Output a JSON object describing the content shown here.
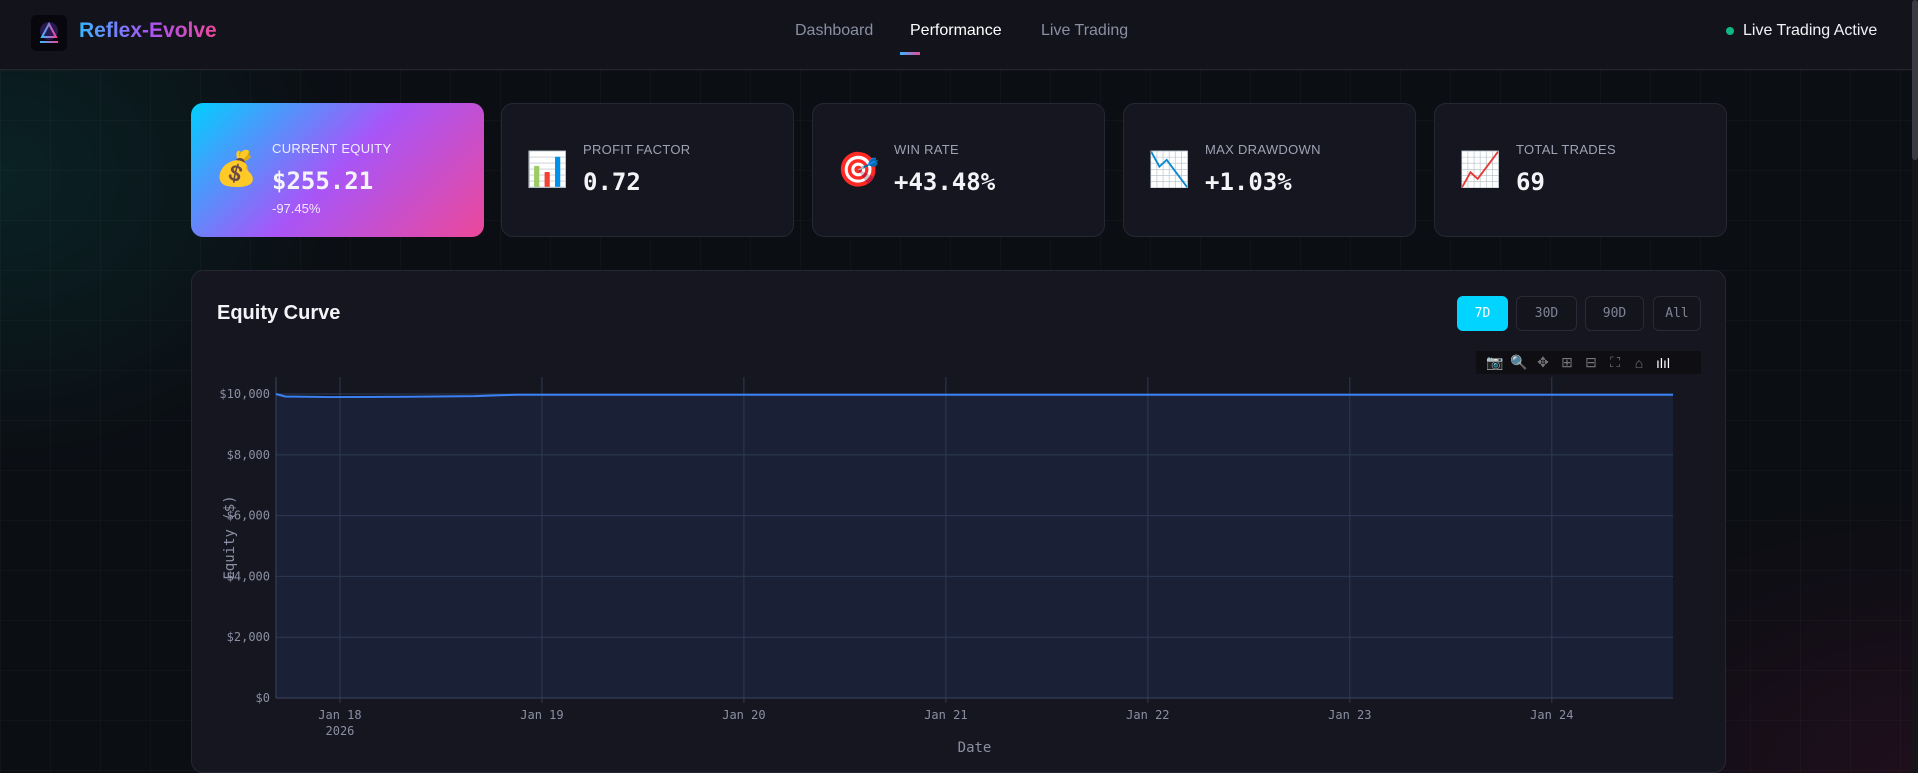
{
  "header": {
    "brand": "Reflex-Evolve",
    "nav": [
      {
        "label": "Dashboard",
        "active": false
      },
      {
        "label": "Performance",
        "active": true
      },
      {
        "label": "Live Trading",
        "active": false
      }
    ],
    "status": "Live Trading Active",
    "status_color": "#10b981"
  },
  "cards": [
    {
      "icon": "money-bag-icon",
      "glyph": "💰",
      "label": "CURRENT EQUITY",
      "value": "$255.21",
      "sub": "-97.45%"
    },
    {
      "icon": "bar-chart-icon",
      "glyph": "📊",
      "label": "PROFIT FACTOR",
      "value": "0.72"
    },
    {
      "icon": "target-icon",
      "glyph": "🎯",
      "label": "WIN RATE",
      "value": "+43.48%"
    },
    {
      "icon": "chart-decreasing-icon",
      "glyph": "📉",
      "label": "MAX DRAWDOWN",
      "value": "+1.03%"
    },
    {
      "icon": "chart-increasing-icon",
      "glyph": "📈",
      "label": "TOTAL TRADES",
      "value": "69"
    }
  ],
  "panel": {
    "title": "Equity Curve",
    "ranges": [
      {
        "label": "7D",
        "active": true
      },
      {
        "label": "30D"
      },
      {
        "label": "90D"
      },
      {
        "label": "All"
      }
    ]
  },
  "modebar": [
    "camera-icon",
    "zoom-icon",
    "pan-icon",
    "zoom-in-icon",
    "zoom-out-icon",
    "autoscale-icon",
    "home-icon",
    "plotly-logo-icon"
  ],
  "chart_data": {
    "type": "area",
    "xlabel": "Date",
    "ylabel": "Equity ($)",
    "ylim": [
      0,
      10560
    ],
    "xlim": [
      "2026-01-17T16:24",
      "2026-01-24T14:24"
    ],
    "yticks": [
      0,
      2000,
      4000,
      6000,
      8000,
      10000
    ],
    "ytick_labels": [
      "$0",
      "$2,000",
      "$4,000",
      "$6,000",
      "$8,000",
      "$10,000"
    ],
    "xticks": [
      "2026-01-18",
      "2026-01-19",
      "2026-01-20",
      "2026-01-21",
      "2026-01-22",
      "2026-01-23",
      "2026-01-24"
    ],
    "xtick_labels": [
      "Jan 18",
      "Jan 19",
      "Jan 20",
      "Jan 21",
      "Jan 22",
      "Jan 23",
      "Jan 24"
    ],
    "xtick_sublabel": "2026",
    "grid": true,
    "line_color": "#3b82f6",
    "fill_color": "#1a2036",
    "x": [
      "2026-01-17T16:24",
      "2026-01-17T17:30",
      "2026-01-17T23:00",
      "2026-01-18T08:00",
      "2026-01-18T16:00",
      "2026-01-18T19:00",
      "2026-01-18T21:00",
      "2026-01-24T14:24"
    ],
    "y": [
      10000,
      9920,
      9900,
      9910,
      9930,
      9960,
      9975,
      9975
    ]
  }
}
